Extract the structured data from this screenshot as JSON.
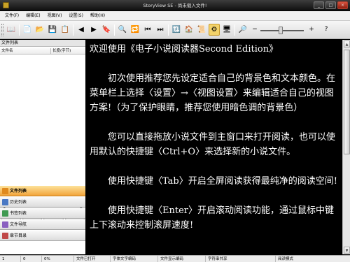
{
  "window": {
    "title": "StoryView SE - 尚未载入文件!",
    "minimize": "_",
    "maximize": "□",
    "close": "×"
  },
  "menu": [
    "文件(F)",
    "编辑(E)",
    "视图(V)",
    "设置(S)",
    "帮助(H)"
  ],
  "toolbar": {
    "buttons": [
      {
        "icon": "reader-icon",
        "glyph": "📖"
      },
      {
        "icon": "new-file-icon",
        "glyph": "📄"
      },
      {
        "icon": "open-folder-icon",
        "glyph": "📂"
      },
      {
        "icon": "save-icon",
        "glyph": "💾"
      },
      {
        "icon": "copy-icon",
        "glyph": "📋"
      },
      {
        "icon": "back-icon",
        "glyph": "◀"
      },
      {
        "icon": "forward-icon",
        "glyph": "▶"
      },
      {
        "icon": "bookmark-icon",
        "glyph": "🔖"
      },
      {
        "icon": "find-icon",
        "glyph": "🔍"
      },
      {
        "icon": "replace-icon",
        "glyph": "🔁"
      },
      {
        "icon": "prev-chapter-icon",
        "glyph": "⏮"
      },
      {
        "icon": "next-chapter-icon",
        "glyph": "⏭"
      },
      {
        "icon": "refresh-icon",
        "glyph": "🔃"
      },
      {
        "icon": "home-icon",
        "glyph": "🏠"
      },
      {
        "icon": "scroll-icon",
        "glyph": "📜"
      },
      {
        "icon": "settings-icon",
        "glyph": "⚙"
      },
      {
        "icon": "fullscreen-icon",
        "glyph": "🖥"
      },
      {
        "icon": "zoom-icon",
        "glyph": "🔎"
      }
    ],
    "slider_left_glyph": "−",
    "slider_right_glyph": "+",
    "help_glyph": "?"
  },
  "sidebar": {
    "panel_title": "文件列表",
    "col_name": "文件名",
    "col_size": "长度(字节)",
    "buttons": [
      "打开",
      "添加",
      "删除",
      "列表"
    ],
    "nav": [
      {
        "label": "文件列表",
        "icon": "file-list-icon",
        "color": "#e08a1e",
        "active": true
      },
      {
        "label": "历史列表",
        "icon": "history-icon",
        "color": "#4a78c4",
        "active": false
      },
      {
        "label": "书签列表",
        "icon": "bookmark-list-icon",
        "color": "#3f9a52",
        "active": false
      },
      {
        "label": "文件导航",
        "icon": "file-nav-icon",
        "color": "#8a5fc0",
        "active": false
      },
      {
        "label": "章节目录",
        "icon": "chapter-icon",
        "color": "#c04848",
        "active": false
      }
    ]
  },
  "content": {
    "heading": "欢迎使用《电子小说阅读器Second Edition》",
    "paragraphs": [
      "初次使用推荐您先设定适合自己的背景色和文本颜色。在菜单栏上选择〈设置〉→〈视图设置〉来编辑适合自己的视图方案!（为了保护眼睛，推荐您使用暗色调的背景色）",
      "您可以直接拖放小说文件到主窗口来打开阅读，也可以使用默认的快捷键〈Ctrl+O〉来选择新的小说文件。",
      "使用快捷键〈Tab〉开启全屏阅读获得最纯净的阅读空间!",
      "使用快捷键〈Enter〉开启滚动阅读功能，通过鼠标中键上下滚动来控制滚屏速度!"
    ]
  },
  "status": {
    "items": [
      "1",
      "0",
      "0%",
      "文件已打开",
      "字体文字编码",
      "文件显示编码",
      "字符串共享",
      "阅读模式"
    ]
  },
  "colors": {
    "reader_bg": "#000000",
    "reader_text": "#ffffff",
    "nav_active": "#f2a43a"
  }
}
